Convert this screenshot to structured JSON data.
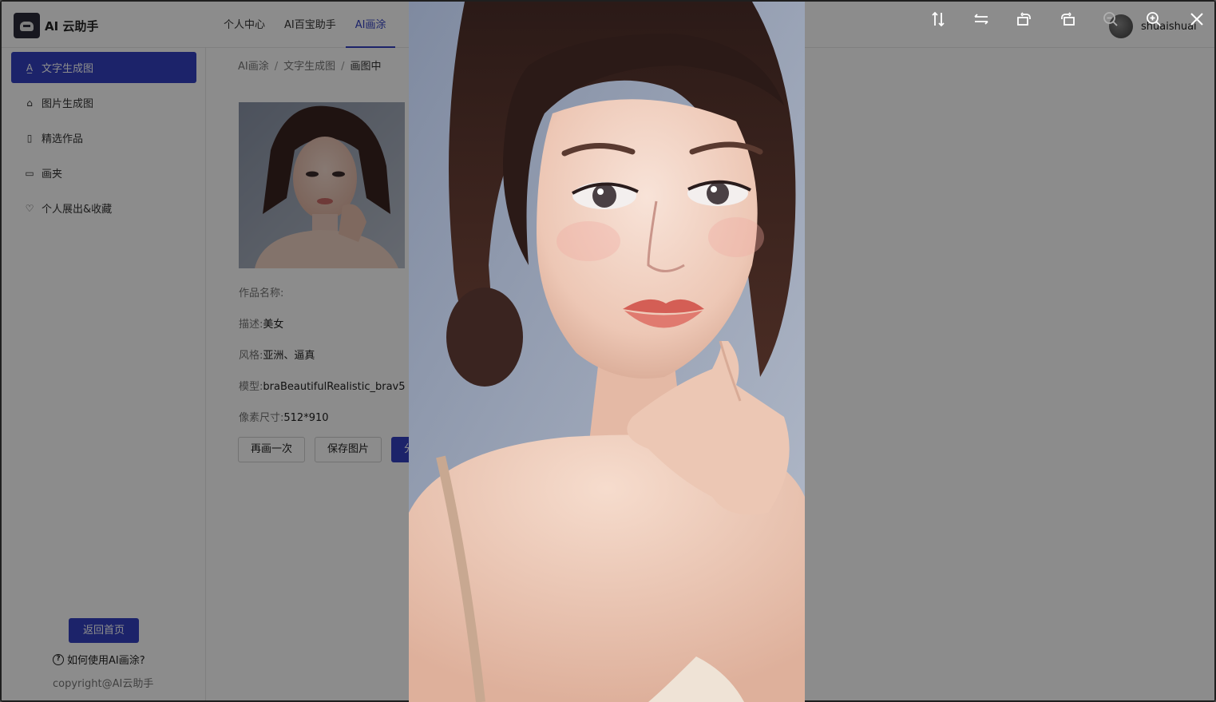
{
  "app": {
    "title": "AI 云助手"
  },
  "nav": {
    "items": [
      "个人中心",
      "AI百宝助手",
      "AI画涂"
    ]
  },
  "user": {
    "name": "shuaishuai"
  },
  "sidebar": {
    "items": [
      {
        "label": "文字生成图",
        "icon": "font-icon"
      },
      {
        "label": "图片生成图",
        "icon": "paint-bucket-icon"
      },
      {
        "label": "精选作品",
        "icon": "document-icon"
      },
      {
        "label": "画夹",
        "icon": "folder-icon"
      },
      {
        "label": "个人展出&收藏",
        "icon": "heart-icon"
      }
    ],
    "home_button": "返回首页",
    "help_text": "如何使用AI画涂?",
    "copyright": "copyright@AI云助手"
  },
  "breadcrumb": {
    "level1": "AI画涂",
    "level2": "文字生成图",
    "level3": "画图中"
  },
  "work": {
    "name_label": "作品名称:",
    "name_value": "",
    "desc_label": "描述:",
    "desc_value": "美女",
    "style_label": "风格:",
    "style_value": "亚洲、逼真",
    "model_label": "模型:",
    "model_value": "braBeautifulRealistic_brav5",
    "size_label": "像素尺寸:",
    "size_value": "512*910"
  },
  "actions": {
    "redraw": "再画一次",
    "save": "保存图片",
    "share": "分"
  },
  "preview": {
    "toolbar": [
      "flip-vertical-icon",
      "flip-horizontal-icon",
      "rotate-left-icon",
      "rotate-right-icon",
      "zoom-out-icon",
      "zoom-in-icon",
      "close-icon"
    ]
  },
  "colors": {
    "accent": "#3341c2",
    "overlay": "rgba(0,0,0,0.45)"
  }
}
